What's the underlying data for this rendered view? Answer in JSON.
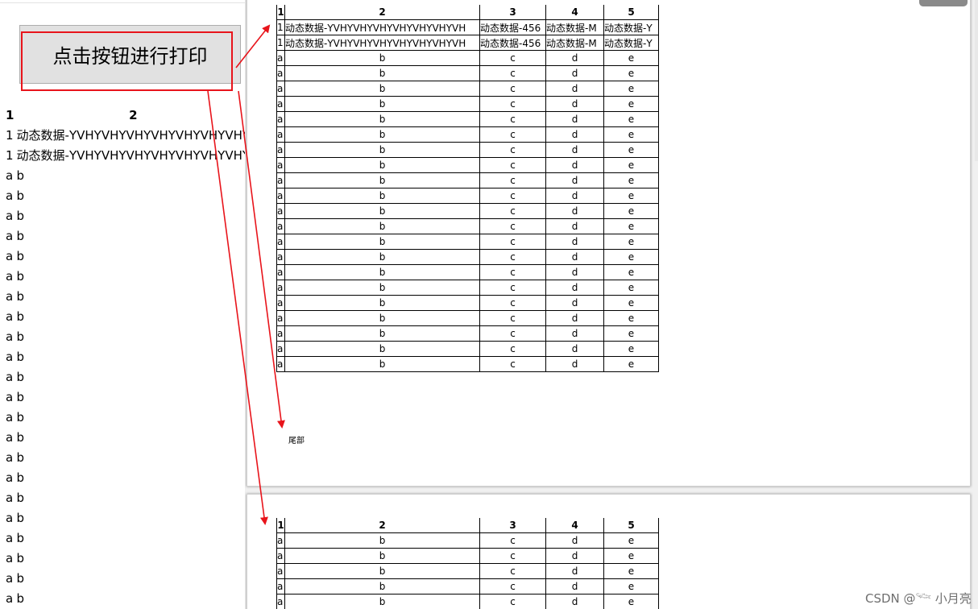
{
  "left": {
    "button_label": "点击按钮进行打印",
    "table": {
      "headers": [
        "1",
        "2"
      ],
      "dynamic_rows": [
        [
          "1",
          "动态数据-YVHYVHYVHYVHYVHYVHYVHY"
        ],
        [
          "1",
          "动态数据-YVHYVHYVHYVHYVHYVHYVHY"
        ]
      ],
      "repeat_row": [
        "a",
        "b"
      ],
      "repeat_count": 22
    }
  },
  "preview": {
    "headers": [
      "1",
      "2",
      "3",
      "4",
      "5"
    ],
    "dynamic_rows": [
      [
        "1",
        "动态数据-YVHYVHYVHYVHYVHYVHYVH",
        "动态数据-456",
        "动态数据-M",
        "动态数据-Y"
      ],
      [
        "1",
        "动态数据-YVHYVHYVHYVHYVHYVHYVH",
        "动态数据-456",
        "动态数据-M",
        "动态数据-Y"
      ]
    ],
    "repeat_row": [
      "a",
      "b",
      "c",
      "d",
      "e"
    ],
    "page1_repeat_count": 21,
    "page2_repeat_count": 5,
    "footer": "尾部"
  },
  "watermark": "CSDN @𓆝 小月亮",
  "colors": {
    "annotation_red": "#e8141b",
    "button_bg": "#e1e1e1",
    "preview_bg": "#f0f0f0"
  }
}
